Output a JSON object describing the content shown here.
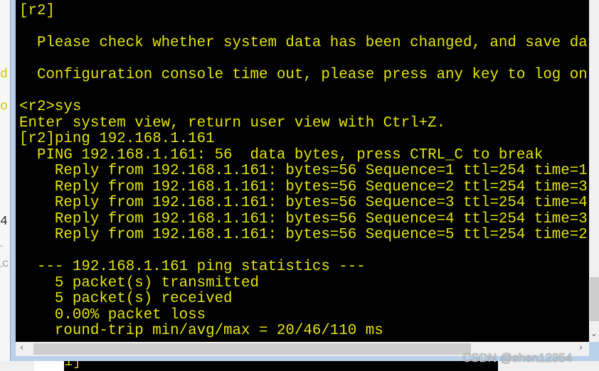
{
  "background_fragments": [
    "d",
    "o",
    "4",
    "-",
    ",C"
  ],
  "terminal": {
    "text_color": "#e4e400",
    "background": "#000000",
    "lines": [
      "[r2]",
      "",
      "  Please check whether system data has been changed, and save data",
      "",
      "  Configuration console time out, please press any key to log on",
      "",
      "<r2>sys",
      "Enter system view, return user view with Ctrl+Z.",
      "[r2]ping 192.168.1.161",
      "  PING 192.168.1.161: 56  data bytes, press CTRL_C to break",
      "    Reply from 192.168.1.161: bytes=56 Sequence=1 ttl=254 time=1",
      "    Reply from 192.168.1.161: bytes=56 Sequence=2 ttl=254 time=3",
      "    Reply from 192.168.1.161: bytes=56 Sequence=3 ttl=254 time=4",
      "    Reply from 192.168.1.161: bytes=56 Sequence=4 ttl=254 time=3",
      "    Reply from 192.168.1.161: bytes=56 Sequence=5 ttl=254 time=2",
      "",
      "  --- 192.168.1.161 ping statistics ---",
      "    5 packet(s) transmitted",
      "    5 packet(s) received",
      "    0.00% packet loss",
      "    round-trip min/avg/max = 20/46/110 ms"
    ]
  },
  "bottom_fragment": "1]",
  "icons": {
    "scroll_left": "chevron-left-icon",
    "scroll_right": "chevron-right-icon",
    "scroll_down": "chevron-down-icon"
  },
  "watermark": "CSDN @shen12354"
}
